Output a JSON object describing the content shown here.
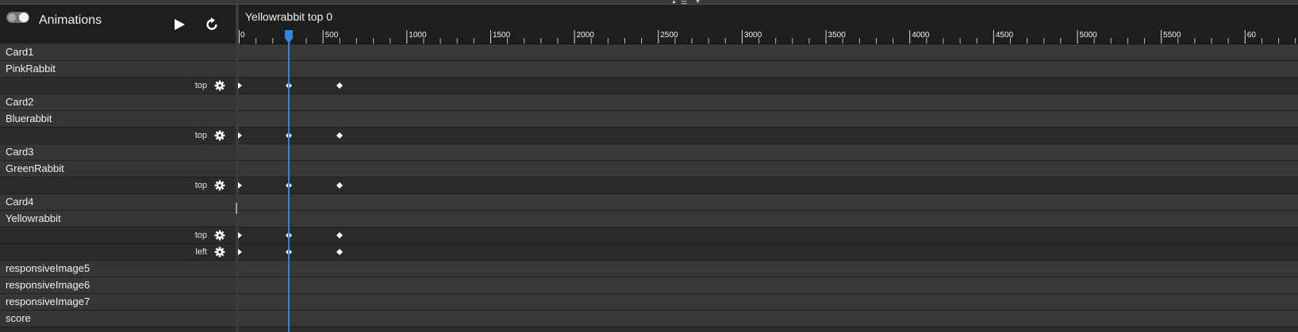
{
  "panel": {
    "title": "Animations",
    "play_icon": "play-icon",
    "refresh_icon": "refresh-icon",
    "toggle_icon": "toggle-switch"
  },
  "timeline": {
    "title": "Yellowrabbit top 0",
    "ruler_labels": [
      "0",
      "500",
      "1000",
      "1500",
      "2000",
      "2500",
      "3000",
      "3500",
      "4000",
      "4500",
      "5000",
      "5500",
      "60"
    ],
    "playhead_ms": 300,
    "keyframe_times_ms": [
      0,
      300,
      600
    ]
  },
  "rows": [
    {
      "type": "element",
      "label": "Card1"
    },
    {
      "type": "element",
      "label": "PinkRabbit"
    },
    {
      "type": "property",
      "label": "top"
    },
    {
      "type": "element",
      "label": "Card2"
    },
    {
      "type": "element",
      "label": "Bluerabbit"
    },
    {
      "type": "property",
      "label": "top"
    },
    {
      "type": "element",
      "label": "Card3"
    },
    {
      "type": "element",
      "label": "GreenRabbit"
    },
    {
      "type": "property",
      "label": "top"
    },
    {
      "type": "element",
      "label": "Card4"
    },
    {
      "type": "element",
      "label": "Yellowrabbit"
    },
    {
      "type": "property",
      "label": "top"
    },
    {
      "type": "property",
      "label": "left"
    },
    {
      "type": "element",
      "label": "responsiveImage5"
    },
    {
      "type": "element",
      "label": "responsiveImage6"
    },
    {
      "type": "element",
      "label": "responsiveImage7"
    },
    {
      "type": "element",
      "label": "score"
    }
  ],
  "colors": {
    "accent": "#2f86e0",
    "panel_bg": "#2a2a2a",
    "header_bg": "#1e1e1e"
  }
}
